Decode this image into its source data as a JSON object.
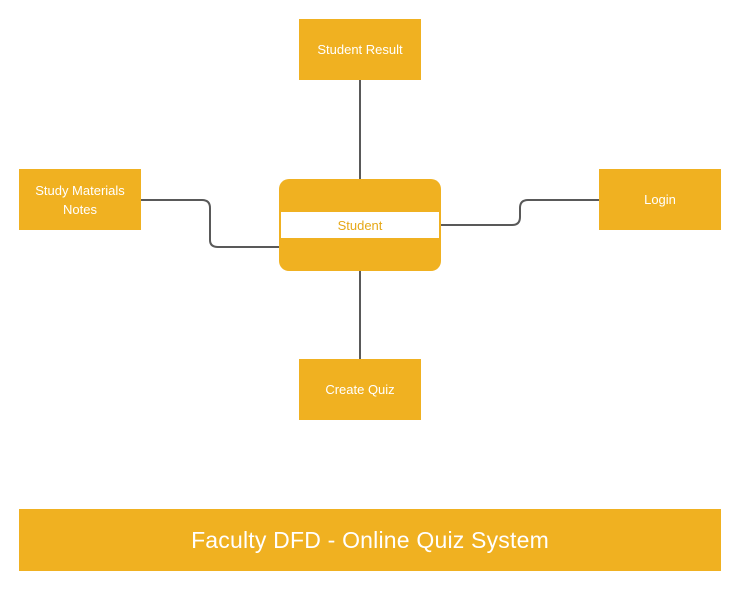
{
  "diagram": {
    "title": "Faculty DFD - Online Quiz System",
    "process": {
      "label": "Student"
    },
    "entities": {
      "student_result": "Student Result",
      "study_materials_line1": "Study Materials",
      "study_materials_line2": "Notes",
      "login": "Login",
      "create_quiz": "Create Quiz"
    },
    "colors": {
      "node_fill": "#f0b121",
      "node_text": "#ffffff",
      "process_label": "#e6a817",
      "connector": "#595959"
    }
  }
}
